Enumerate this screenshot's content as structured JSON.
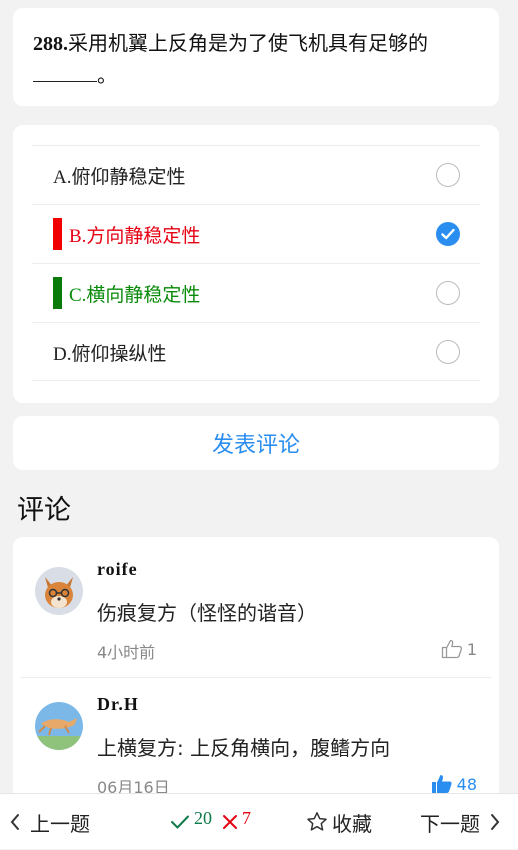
{
  "question": {
    "number": "288.",
    "text": "采用机翼上反角是为了使飞机具有足够的",
    "suffix": "。"
  },
  "options": [
    {
      "label": "A.俯仰静稳定性",
      "state": "none",
      "checked": false
    },
    {
      "label": "B.方向静稳定性",
      "state": "wrong",
      "checked": true
    },
    {
      "label": "C.横向静稳定性",
      "state": "correct",
      "checked": false
    },
    {
      "label": "D.俯仰操纵性",
      "state": "none",
      "checked": false
    }
  ],
  "comment_button": "发表评论",
  "comments_title": "评论",
  "comments": [
    {
      "user": "roife",
      "text": "伤痕复方（怪怪的谐音）",
      "time": "4小时前",
      "likes": "1",
      "liked": false
    },
    {
      "user": "Dr.H",
      "text": "上横复方: 上反角横向，腹鳍方向",
      "time": "06月16日",
      "likes": "48",
      "liked": true
    }
  ],
  "bottom_bar": {
    "prev": "上一题",
    "correct_count": "20",
    "wrong_count": "7",
    "favorite": "收藏",
    "next": "下一题"
  },
  "colors": {
    "accent": "#2a8ef0",
    "wrong": "#e60012",
    "correct": "#0a8a0a"
  }
}
